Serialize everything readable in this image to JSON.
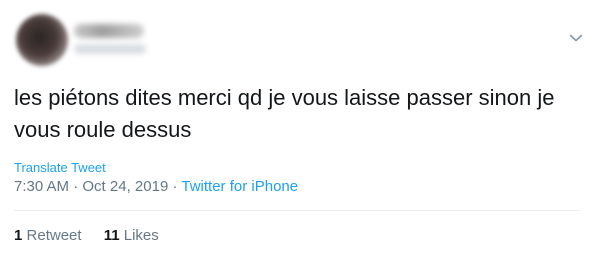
{
  "tweet": {
    "text": "les piétons dites merci qd je vous laisse passer sinon je vous roule dessus",
    "translate_label": "Translate Tweet",
    "time": "7:30 AM",
    "date": "Oct 24, 2019",
    "separator": "·",
    "source": "Twitter for iPhone"
  },
  "stats": {
    "retweets_count": "1",
    "retweets_label": "Retweet",
    "likes_count": "11",
    "likes_label": "Likes"
  },
  "colors": {
    "link": "#1da1f2",
    "muted": "#657786",
    "text": "#14171a",
    "divider": "#e6ecf0"
  },
  "icons": {
    "menu": "chevron-down-icon"
  }
}
